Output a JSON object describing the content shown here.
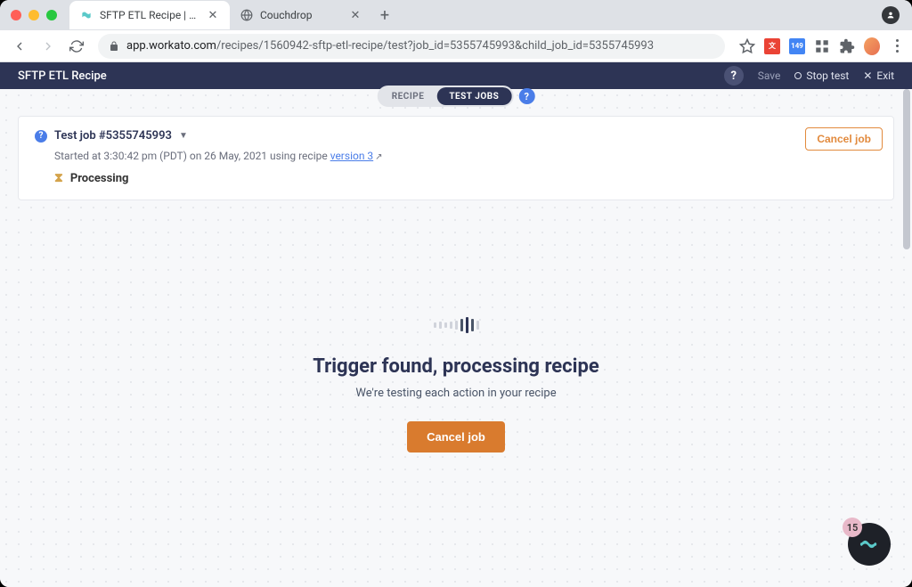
{
  "browser": {
    "tabs": [
      {
        "title": "SFTP ETL Recipe | Workato"
      },
      {
        "title": "Couchdrop"
      }
    ],
    "url_domain": "app.workato.com",
    "url_path": "/recipes/1560942-sftp-etl-recipe/test?job_id=5355745993&child_job_id=5355745993"
  },
  "header": {
    "title": "SFTP ETL Recipe",
    "save": "Save",
    "stop_test": "Stop test",
    "exit": "Exit"
  },
  "pill": {
    "recipe": "RECIPE",
    "test_jobs": "TEST JOBS"
  },
  "job_card": {
    "title": "Test job #5355745993",
    "started_prefix": "Started at 3:30:42 pm (PDT) on 26 May, 2021 using recipe ",
    "version_link": "version 3",
    "status": "Processing",
    "cancel": "Cancel job"
  },
  "stage": {
    "title": "Trigger found, processing recipe",
    "subtitle": "We're testing each action in your recipe",
    "cancel": "Cancel job"
  },
  "chat": {
    "badge": "15"
  }
}
